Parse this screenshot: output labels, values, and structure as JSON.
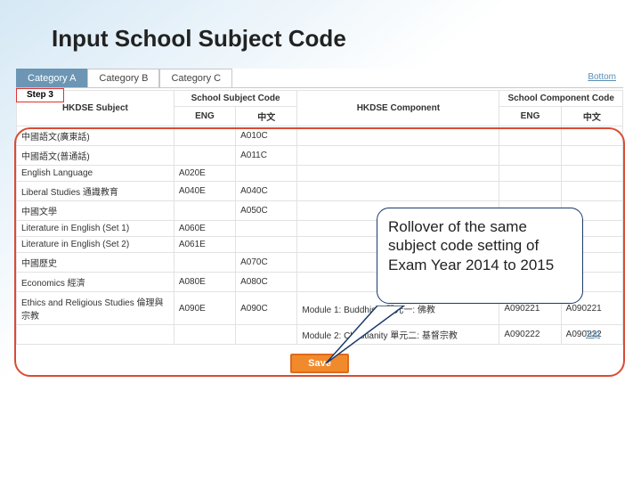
{
  "slide_title": "Input School Subject Code",
  "tabs": {
    "a": "Category A",
    "b": "Category B",
    "c": "Category C"
  },
  "links": {
    "bottom": "Bottom",
    "top": "Top"
  },
  "step_label": "Step 3",
  "headers": {
    "hkdse_subject": "HKDSE Subject",
    "school_subject_code": "School Subject Code",
    "eng": "ENG",
    "chi": "中文",
    "hkdse_component": "HKDSE Component",
    "school_component_code": "School Component Code"
  },
  "rows": [
    {
      "subject": "中國語文(廣東話)",
      "eng": "",
      "chi": "A010C",
      "component": "",
      "ceng": "",
      "cchi": ""
    },
    {
      "subject": "中國語文(普通話)",
      "eng": "",
      "chi": "A011C",
      "component": "",
      "ceng": "",
      "cchi": ""
    },
    {
      "subject": "English Language",
      "eng": "A020E",
      "chi": "",
      "component": "",
      "ceng": "",
      "cchi": ""
    },
    {
      "subject": "Liberal Studies 通識教育",
      "eng": "A040E",
      "chi": "A040C",
      "component": "",
      "ceng": "",
      "cchi": ""
    },
    {
      "subject": "中國文學",
      "eng": "",
      "chi": "A050C",
      "component": "",
      "ceng": "",
      "cchi": ""
    },
    {
      "subject": "Literature in English (Set 1)",
      "eng": "A060E",
      "chi": "",
      "component": "",
      "ceng": "",
      "cchi": ""
    },
    {
      "subject": "Literature in English (Set 2)",
      "eng": "A061E",
      "chi": "",
      "component": "",
      "ceng": "",
      "cchi": ""
    },
    {
      "subject": "中國歷史",
      "eng": "",
      "chi": "A070C",
      "component": "",
      "ceng": "",
      "cchi": ""
    },
    {
      "subject": "Economics 經濟",
      "eng": "A080E",
      "chi": "A080C",
      "component": "",
      "ceng": "",
      "cchi": ""
    },
    {
      "subject": "Ethics and Religious Studies 倫理與宗教",
      "eng": "A090E",
      "chi": "A090C",
      "component": "Module 1: Buddhism 單元一: 佛教",
      "ceng": "A090221",
      "cchi": "A090221"
    },
    {
      "subject": "",
      "eng": "",
      "chi": "",
      "component": "Module 2: Christianity 單元二: 基督宗教",
      "ceng": "A090222",
      "cchi": "A090222"
    }
  ],
  "callout_text": "Rollover of the same subject code setting of Exam Year 2014 to 2015",
  "save_label": "Save"
}
